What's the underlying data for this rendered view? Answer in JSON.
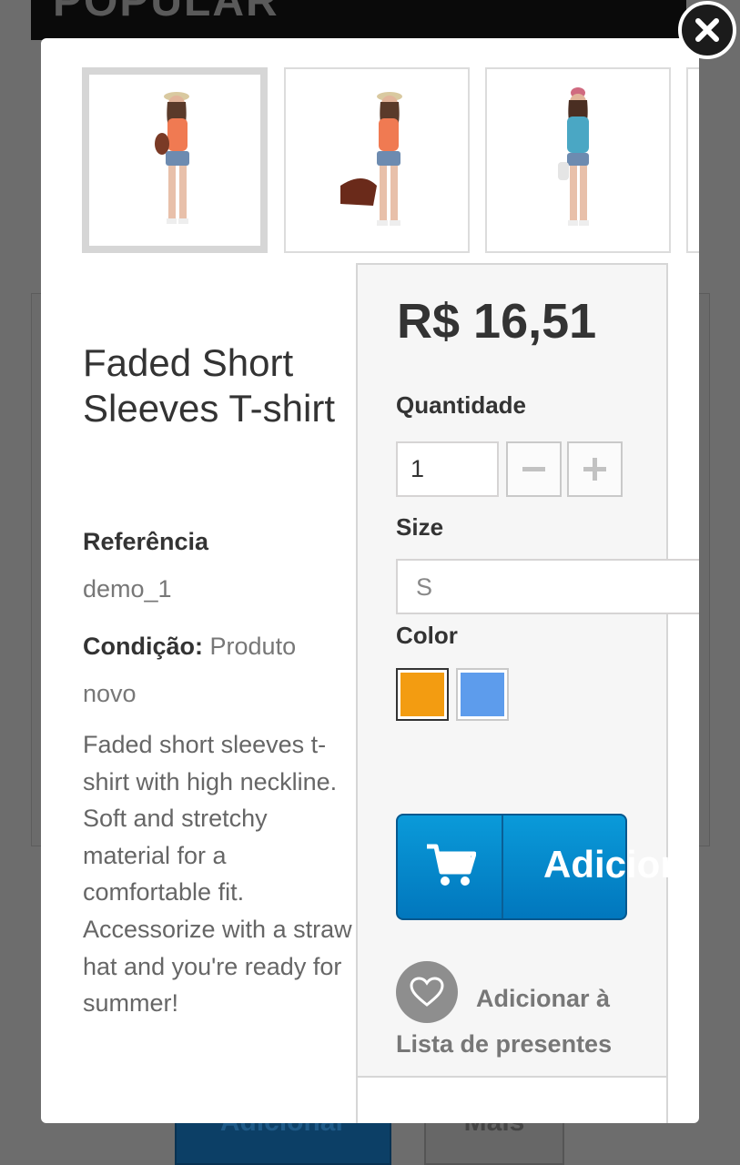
{
  "background": {
    "top_heading": "POPULAR",
    "left_button": "Adicionar",
    "right_button": "Mais"
  },
  "product": {
    "title": "Faded Short Sleeves T-shirt",
    "reference_label": "Referência",
    "reference_value": "demo_1",
    "condition_label": "Condição:",
    "condition_value": "Produto novo",
    "description": "Faded short sleeves t-shirt with high neckline. Soft and stretchy material for a comfortable fit. Accessorize with a straw hat and you're ready for summer!"
  },
  "gallery": {
    "thumbnails": [
      {
        "name": "model orange top front",
        "selected": true
      },
      {
        "name": "model orange top with bag",
        "selected": false
      },
      {
        "name": "model blue top",
        "selected": false
      }
    ]
  },
  "buybox": {
    "price": "R$ 16,51",
    "quantity_label": "Quantidade",
    "quantity_value": "1",
    "minus_symbol": "−",
    "plus_symbol": "+",
    "size_label": "Size",
    "size_value": "S",
    "color_label": "Color",
    "colors": [
      {
        "name": "Orange",
        "hex": "#f39c11",
        "selected": true
      },
      {
        "name": "Blue",
        "hex": "#5d9cec",
        "selected": false
      }
    ],
    "add_to_cart_label": "Adicionar",
    "wishlist_label": "Adicionar à Lista de presentes"
  },
  "icons": {
    "close": "close-icon",
    "cart": "cart-icon",
    "wishlist": "heart-icon"
  },
  "colors": {
    "accent_blue": "#0a9ad9",
    "modal_bg": "#ffffff",
    "buybox_bg": "#f6f6f6"
  }
}
